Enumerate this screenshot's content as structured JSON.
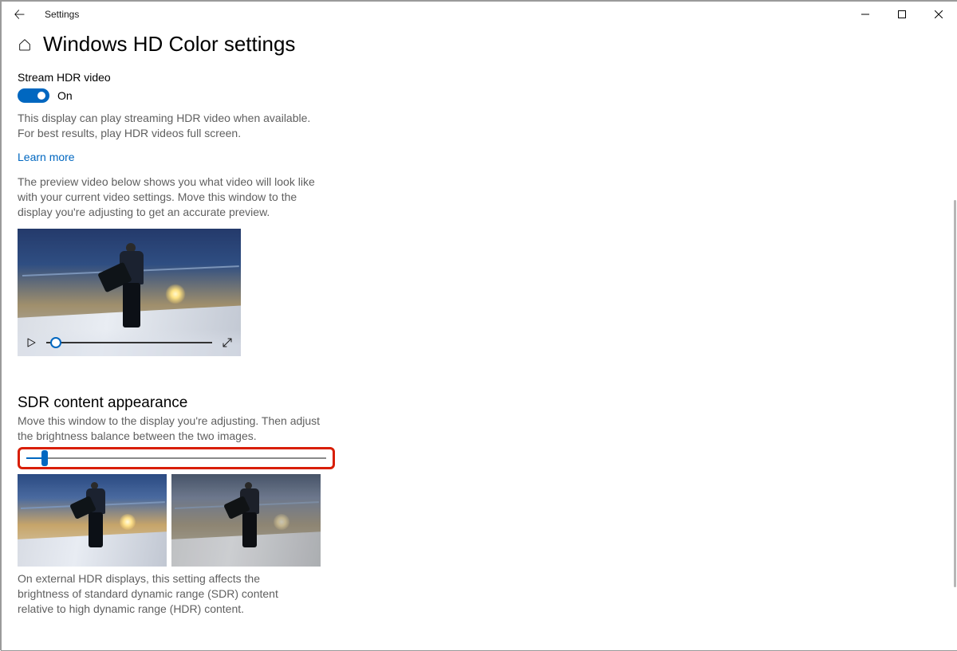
{
  "window": {
    "app_title": "Settings"
  },
  "page": {
    "title": "Windows HD Color settings"
  },
  "stream_hdr": {
    "label": "Stream HDR video",
    "toggle_state": "On",
    "description": "This display can play streaming HDR video when available. For best results, play HDR videos full screen.",
    "learn_more": "Learn more",
    "preview_desc": "The preview video below shows you what video will look like with your current video settings. Move this window to the display you're adjusting to get an accurate preview."
  },
  "preview_player": {
    "progress_percent": 6
  },
  "sdr": {
    "title": "SDR content appearance",
    "instruction": "Move this window to the display you're adjusting. Then adjust the brightness balance between the two images.",
    "slider_percent": 6,
    "footnote": "On external HDR displays, this setting affects the brightness of standard dynamic range (SDR) content relative to high dynamic range (HDR) content."
  },
  "colors": {
    "accent": "#0067c0",
    "highlight_border": "#d81e05"
  }
}
